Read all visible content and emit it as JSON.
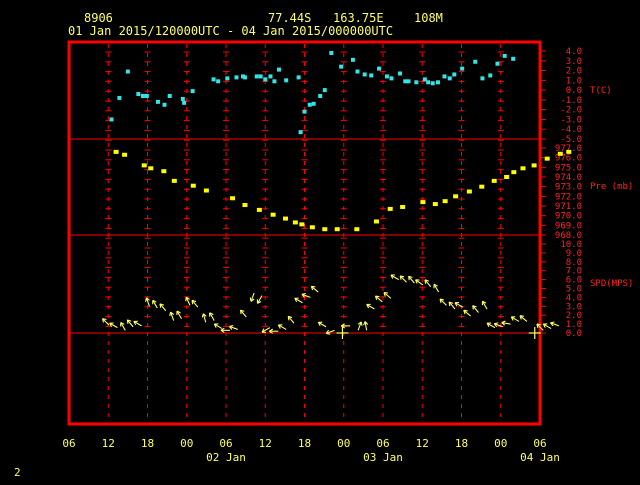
{
  "header": {
    "station_id": "8906",
    "lat": "77.44S",
    "lon": "163.75E",
    "elevation": "108M",
    "time_range": "01 Jan 2015/120000UTC - 04 Jan 2015/000000UTC"
  },
  "page_number": "2",
  "colors": {
    "background": "#000000",
    "frame": "#ff0000",
    "text": "#ffff66",
    "axis_text": "#ff2222",
    "temperature": "#33e5e5",
    "pressure": "#ffff00",
    "wind": "#ffff66"
  },
  "chart_data": {
    "type": "scatter",
    "x_axis": {
      "hour_ticks": [
        "06",
        "12",
        "18",
        "00",
        "06",
        "12",
        "18",
        "00",
        "06",
        "12",
        "18",
        "00",
        "06"
      ],
      "day_labels": [
        "02 Jan",
        "03 Jan",
        "04 Jan"
      ],
      "range_hours_from_jan1_00utc": [
        6,
        78
      ]
    },
    "panels": [
      {
        "id": "temperature",
        "label": "T(C)",
        "ylim": [
          -5.0,
          4.0
        ],
        "ticks": [
          "4.0",
          "3.0",
          "2.0",
          "1.0",
          "0.0",
          "-1.0",
          "-2.0",
          "-3.0",
          "-4.0",
          "-5.0"
        ],
        "series": {
          "hours": [
            12.5,
            13.7,
            15.0,
            16.6,
            17.3,
            17.9,
            19.6,
            20.6,
            21.4,
            23.4,
            23.6,
            24.9,
            28.1,
            28.8,
            30.2,
            31.6,
            32.6,
            32.9,
            34.7,
            35.3,
            36.0,
            36.8,
            37.4,
            38.1,
            39.2,
            41.1,
            41.4,
            42.0,
            42.8,
            43.4,
            44.4,
            45.1,
            46.1,
            47.6,
            49.4,
            50.1,
            51.2,
            52.2,
            53.4,
            54.6,
            55.3,
            56.6,
            57.4,
            57.9,
            59.1,
            60.4,
            60.9,
            61.6,
            62.4,
            63.4,
            64.2,
            64.9,
            66.1,
            68.1,
            69.2,
            70.4,
            71.5,
            72.6,
            73.9
          ],
          "values": [
            -3.0,
            -0.8,
            1.9,
            -0.4,
            -0.6,
            -0.6,
            -1.2,
            -1.5,
            -0.6,
            -0.9,
            -1.3,
            -0.1,
            1.1,
            0.9,
            1.2,
            1.3,
            1.4,
            1.3,
            1.4,
            1.4,
            1.1,
            1.4,
            0.9,
            2.1,
            1.0,
            1.3,
            -4.3,
            -2.2,
            -1.5,
            -1.4,
            -0.6,
            0.0,
            3.8,
            2.4,
            3.1,
            1.9,
            1.6,
            1.5,
            2.2,
            1.4,
            1.2,
            1.7,
            0.9,
            0.9,
            0.8,
            1.1,
            0.8,
            0.7,
            0.8,
            1.4,
            1.2,
            1.6,
            2.2,
            2.9,
            1.2,
            1.5,
            2.7,
            3.5,
            3.2
          ]
        }
      },
      {
        "id": "pressure",
        "label": "Pre (mb)",
        "ylim": [
          968.0,
          977.0
        ],
        "ticks": [
          "977.0",
          "976.0",
          "975.0",
          "974.0",
          "973.0",
          "972.0",
          "971.0",
          "970.0",
          "969.0",
          "968.0"
        ],
        "series": {
          "hours": [
            13.2,
            14.5,
            17.5,
            18.5,
            20.5,
            22.1,
            25.0,
            27.0,
            31.0,
            32.9,
            35.1,
            37.2,
            39.1,
            40.6,
            41.6,
            43.2,
            45.1,
            47.0,
            50.0,
            53.0,
            55.1,
            57.0,
            60.1,
            62.0,
            63.5,
            65.1,
            67.2,
            69.1,
            71.0,
            72.9,
            74.0,
            75.4,
            77.1,
            79.1,
            81.1,
            82.4
          ],
          "values": [
            976.6,
            976.3,
            975.2,
            974.9,
            974.6,
            973.6,
            973.1,
            972.6,
            971.8,
            971.1,
            970.6,
            970.1,
            969.7,
            969.3,
            969.1,
            968.8,
            968.6,
            968.6,
            968.6,
            969.4,
            970.7,
            970.9,
            971.4,
            971.2,
            971.5,
            972.0,
            972.5,
            973.0,
            973.6,
            974.0,
            974.5,
            974.9,
            975.2,
            975.9,
            976.4,
            976.6
          ]
        }
      },
      {
        "id": "wind_speed",
        "label": "SPD(MPS)",
        "ylim": [
          0.0,
          10.0
        ],
        "ticks": [
          "10.0",
          "9.0",
          "8.0",
          "7.0",
          "6.0",
          "5.0",
          "4.0",
          "3.0",
          "2.0",
          "1.0",
          "0.0"
        ],
        "series": {
          "hours": [
            12.1,
            13.4,
            14.6,
            15.8,
            17.1,
            18.3,
            19.5,
            20.8,
            22.0,
            23.2,
            24.5,
            25.7,
            26.9,
            28.2,
            29.4,
            30.6,
            31.8,
            33.1,
            34.3,
            35.5,
            36.7,
            38.0,
            39.2,
            40.4,
            41.7,
            42.9,
            44.1,
            45.3,
            46.6,
            47.8,
            49.0,
            50.2,
            51.5,
            52.7,
            53.9,
            55.2,
            56.4,
            57.6,
            58.8,
            60.1,
            61.3,
            62.5,
            63.7,
            65.0,
            66.2,
            67.4,
            68.6,
            69.9,
            71.1,
            72.3,
            73.5,
            74.8,
            76.0,
            77.2,
            78.5,
            79.7,
            80.9
          ],
          "values": [
            0.9,
            0.6,
            0.3,
            0.7,
            0.8,
            3.0,
            2.8,
            2.5,
            1.4,
            1.6,
            3.1,
            2.9,
            1.2,
            1.4,
            0.5,
            0.3,
            0.4,
            1.8,
            4.5,
            4.2,
            0.6,
            0.2,
            0.4,
            1.1,
            3.4,
            4.0,
            4.6,
            0.7,
            0.3,
            0.0,
            0.8,
            0.3,
            0.3,
            2.7,
            3.5,
            3.9,
            6.0,
            5.7,
            5.6,
            5.4,
            5.2,
            4.6,
            3.1,
            2.7,
            2.9,
            1.9,
            2.3,
            2.7,
            0.6,
            0.7,
            1.0,
            1.3,
            1.3,
            0.0,
            0.3,
            0.5,
            0.8
          ],
          "direction_deg": [
            315,
            300,
            330,
            320,
            300,
            340,
            330,
            320,
            340,
            330,
            335,
            320,
            345,
            330,
            300,
            270,
            290,
            320,
            200,
            210,
            240,
            270,
            300,
            320,
            300,
            290,
            310,
            300,
            250,
            270,
            270,
            20,
            350,
            300,
            310,
            310,
            300,
            315,
            320,
            305,
            320,
            330,
            315,
            320,
            300,
            310,
            320,
            330,
            300,
            290,
            280,
            300,
            310,
            0,
            315,
            300,
            290
          ]
        }
      }
    ]
  }
}
